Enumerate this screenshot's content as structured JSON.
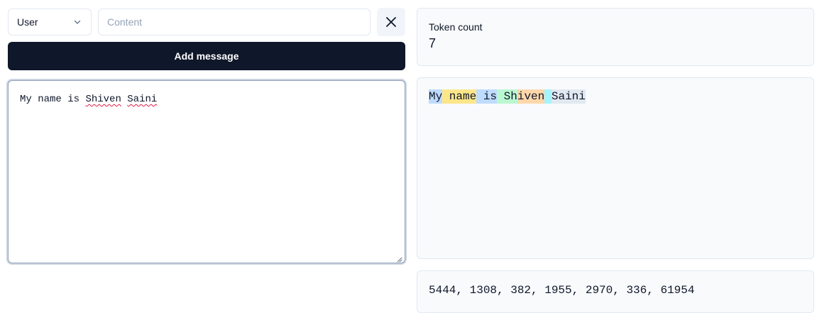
{
  "composer": {
    "role_selected": "User",
    "content_placeholder": "Content",
    "content_value": "",
    "add_button_label": "Add message"
  },
  "editor": {
    "words": [
      "My",
      "name",
      "is",
      "Shiven",
      "Saini"
    ],
    "misspelled": [
      false,
      false,
      false,
      true,
      true
    ]
  },
  "token_count": {
    "label": "Token count",
    "value": "7"
  },
  "tokens": [
    {
      "text": "My",
      "color": "#bfdbfe"
    },
    {
      "text": " name",
      "color": "#fde68a"
    },
    {
      "text": " is",
      "color": "#bfdbfe"
    },
    {
      "text": " Sh",
      "color": "#bbf7d0"
    },
    {
      "text": "iven",
      "color": "#fed7aa"
    },
    {
      "text": " ",
      "color": "#a5f3fc"
    },
    {
      "text": "Saini",
      "color": "#e2e8f0"
    }
  ],
  "token_ids": "5444, 1308, 382, 1955, 2970, 336, 61954"
}
